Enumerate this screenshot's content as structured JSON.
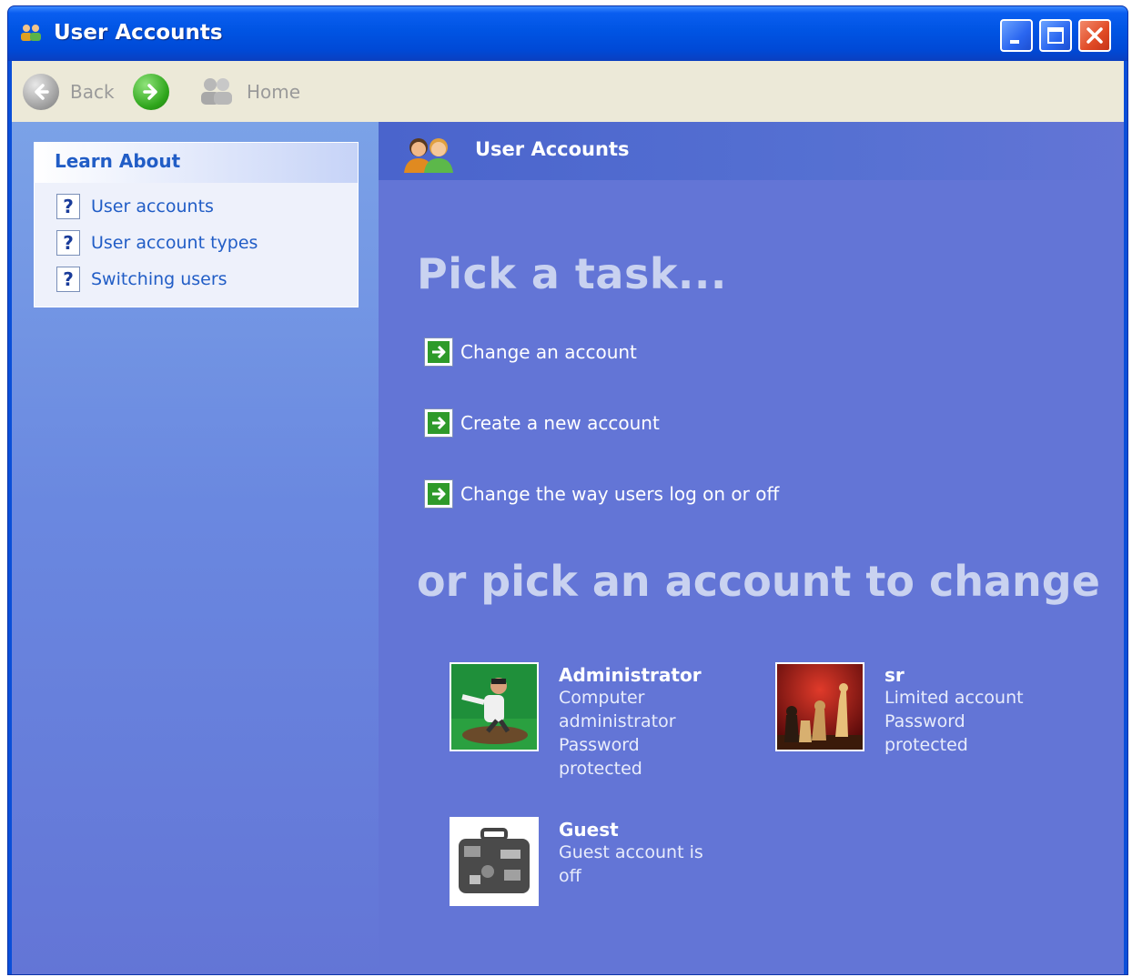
{
  "window": {
    "title": "User Accounts"
  },
  "toolbar": {
    "back_label": "Back",
    "home_label": "Home"
  },
  "learn_about": {
    "heading": "Learn About",
    "items": [
      {
        "label": "User accounts",
        "icon": "help-icon"
      },
      {
        "label": "User account types",
        "icon": "help-icon"
      },
      {
        "label": "Switching users",
        "icon": "help-icon"
      }
    ]
  },
  "header": {
    "title": "User Accounts"
  },
  "tasks": {
    "heading": "Pick a task...",
    "items": [
      {
        "label": "Change an account",
        "icon": "green-arrow-icon"
      },
      {
        "label": "Create a new account",
        "icon": "green-arrow-icon"
      },
      {
        "label": "Change the way users log on or off",
        "icon": "green-arrow-icon"
      }
    ]
  },
  "accounts": {
    "heading": "or pick an account to change",
    "items": [
      {
        "name": "Administrator",
        "lines": [
          "Computer",
          "administrator",
          "Password",
          "protected"
        ],
        "picture": "skateboarder"
      },
      {
        "name": "sr",
        "lines": [
          "Limited account",
          "Password",
          "protected"
        ],
        "picture": "chess"
      },
      {
        "name": "Guest",
        "lines": [
          "Guest account is",
          "off"
        ],
        "picture": "suitcase"
      }
    ]
  },
  "colors": {
    "titlebar": "#0054e3",
    "toolbar": "#ece9d8",
    "content_bg": "#6375d6",
    "link": "#215dc6",
    "heading_text": "#c9d2f0"
  }
}
